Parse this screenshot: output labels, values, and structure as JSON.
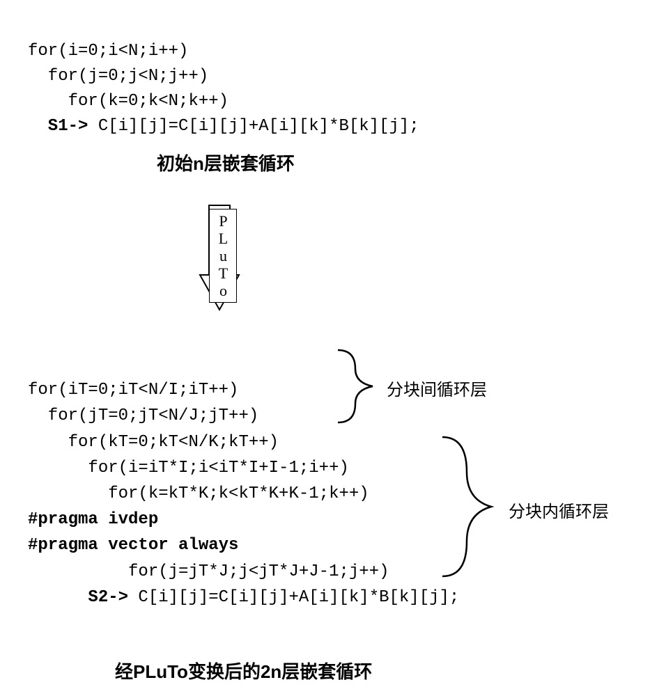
{
  "topCode": {
    "line1": "for(i=0;i<N;i++)",
    "line2": "  for(j=0;j<N;j++)",
    "line3": "    for(k=0;k<N;k++)",
    "line4_prefix": "  S1->",
    "line4_body": " C[i][j]=C[i][j]+A[i][k]*B[k][j];"
  },
  "caption1": "初始n层嵌套循环",
  "arrowLabel": "PLuTo",
  "bottomCode": {
    "line1": "for(iT=0;iT<N/I;iT++)",
    "line2": "  for(jT=0;jT<N/J;jT++)",
    "line3": "    for(kT=0;kT<N/K;kT++)",
    "line4": "      for(i=iT*I;i<iT*I+I-1;i++)",
    "line5": "        for(k=kT*K;k<kT*K+K-1;k++)",
    "pragma1": "#pragma ivdep",
    "pragma2": "#pragma vector always",
    "line6": "          for(j=jT*J;j<jT*J+J-1;j++)",
    "line7_prefix": "      S2->",
    "line7_body": " C[i][j]=C[i][j]+A[i][k]*B[k][j];"
  },
  "braceLabel1": "分块间循环层",
  "braceLabel2": "分块内循环层",
  "caption2": "经PLuTo变换后的2n层嵌套循环"
}
